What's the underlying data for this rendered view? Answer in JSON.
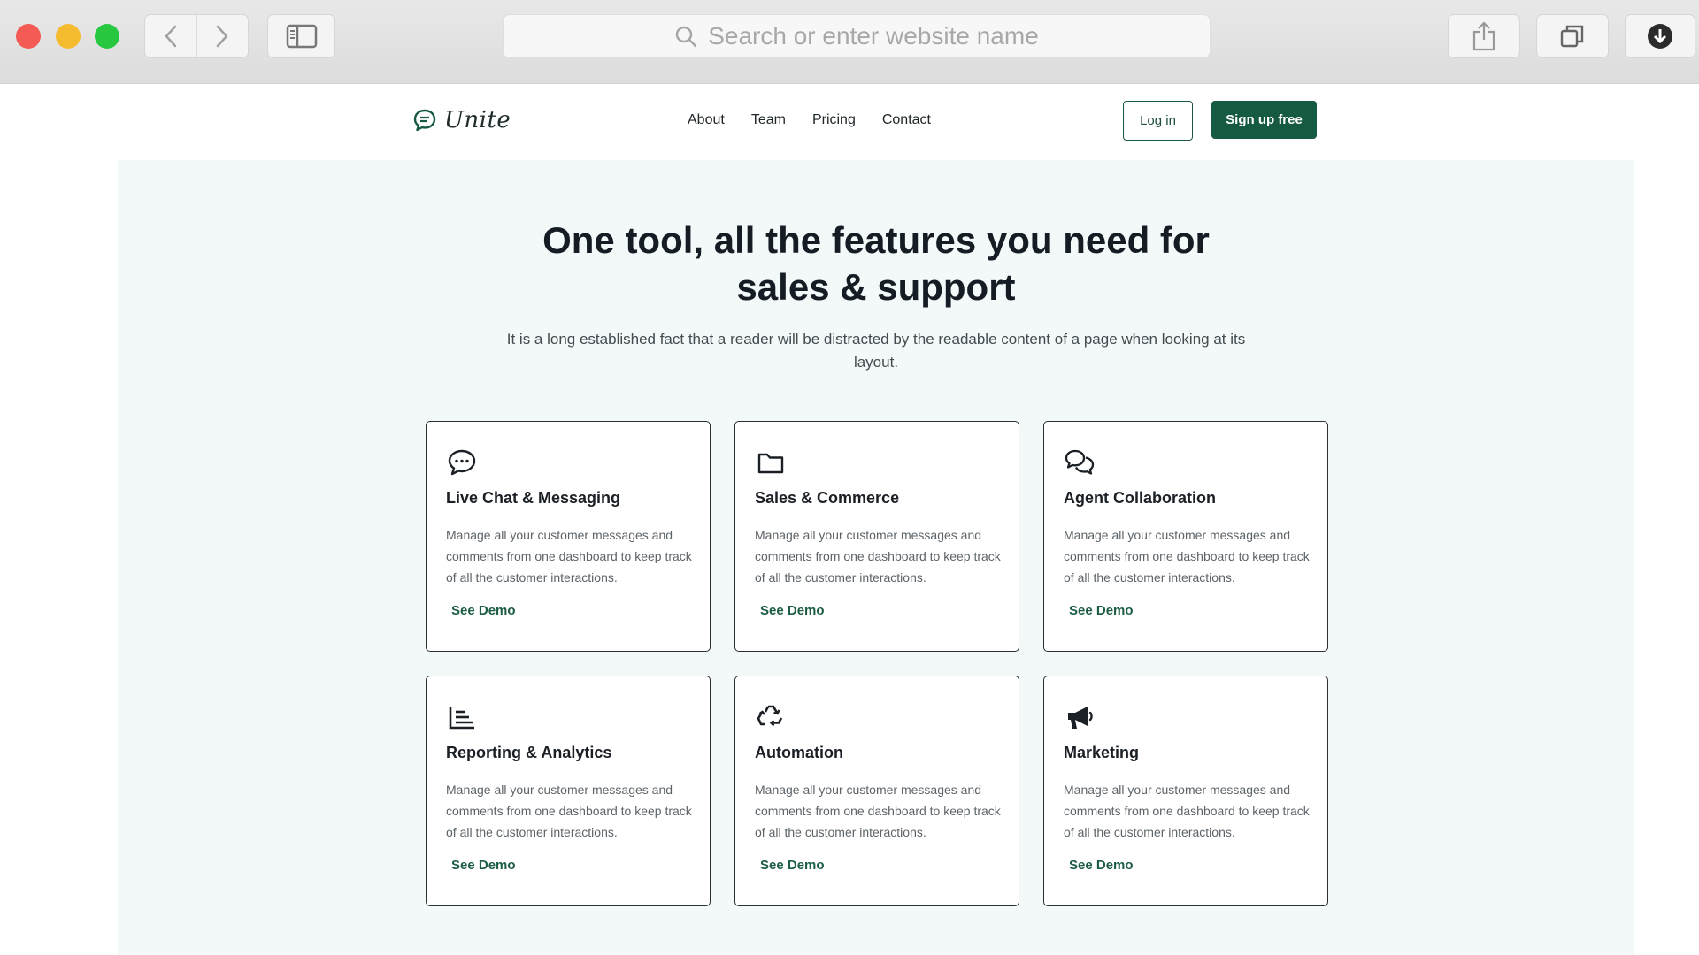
{
  "browser": {
    "address_placeholder": "Search or enter website name",
    "icons": [
      "back-arrow-icon",
      "forward-arrow-icon",
      "sidebar-icon",
      "search-icon",
      "share-icon",
      "tabs-icon",
      "download-icon"
    ]
  },
  "header": {
    "logo_text": "Unite",
    "nav": [
      "About",
      "Team",
      "Pricing",
      "Contact"
    ],
    "login_label": "Log in",
    "signup_label": "Sign up free"
  },
  "hero": {
    "title_line1": "One tool, all the features you need for",
    "title_line2": "sales & support",
    "subtitle": "It is a long established fact that a reader will be distracted by the readable content of a page when looking at its layout."
  },
  "features": [
    {
      "title": "Live Chat & Messaging",
      "icon": "chat-bubble-icon",
      "description": "Manage all your customer messages and comments from one dashboard to keep track of all the customer interactions.",
      "link": "See Demo"
    },
    {
      "title": "Sales & Commerce",
      "icon": "folder-icon",
      "description": "Manage all your customer messages and comments from one dashboard to keep track of all the customer interactions.",
      "link": "See Demo"
    },
    {
      "title": "Agent Collaboration",
      "icon": "conversation-icon",
      "description": "Manage all your customer messages and comments from one dashboard to keep track of all the customer interactions.",
      "link": "See Demo"
    },
    {
      "title": "Reporting & Analytics",
      "icon": "bar-chart-icon",
      "description": "Manage all your customer messages and comments from one dashboard to keep track of all the customer interactions.",
      "link": "See Demo"
    },
    {
      "title": "Automation",
      "icon": "recycle-icon",
      "description": "Manage all your customer messages and comments from one dashboard to keep track of all the customer interactions.",
      "link": "See Demo"
    },
    {
      "title": "Marketing",
      "icon": "megaphone-icon",
      "description": "Manage all your customer messages and comments from one dashboard to keep track of all the customer interactions.",
      "link": "See Demo"
    }
  ],
  "colors": {
    "brand_green": "#155a41",
    "page_background": "#f3f8f8",
    "heading": "#151c24"
  }
}
